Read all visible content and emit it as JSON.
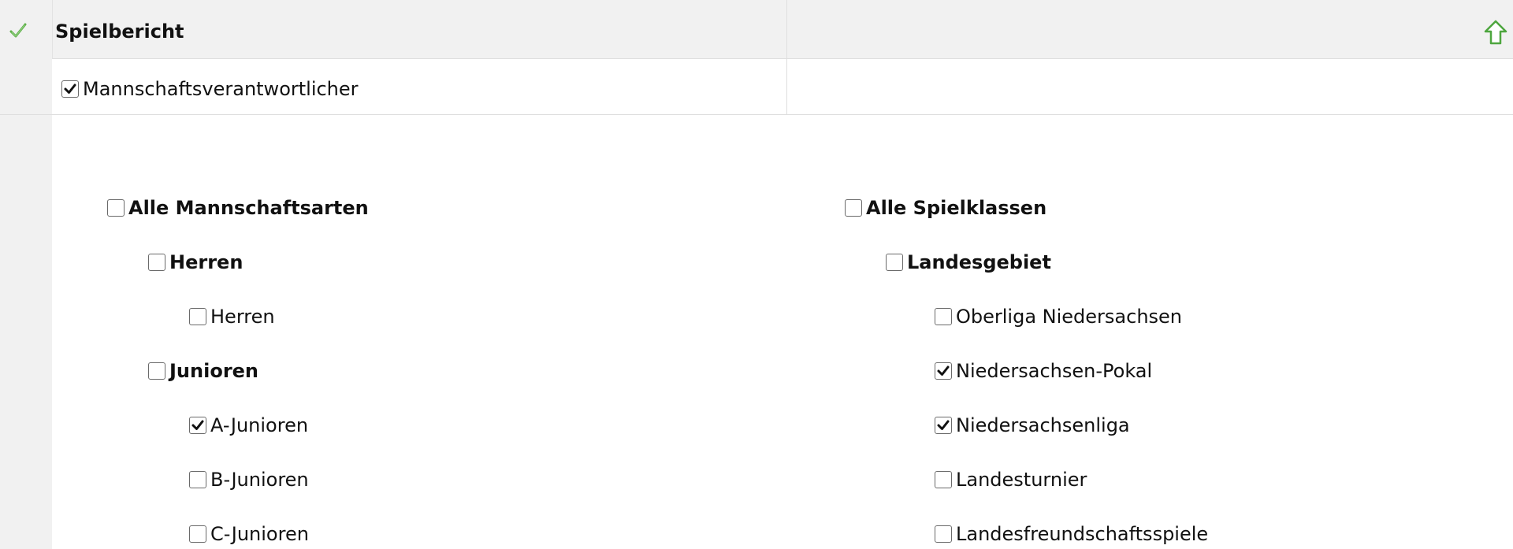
{
  "header": {
    "title": "Spielbericht",
    "status_icon": "green-check-icon",
    "action_icon": "green-up-arrow-icon"
  },
  "role_option": {
    "label": "Mannschaftsverantwortlicher",
    "checked": true
  },
  "left_column": [
    {
      "label": "Alle Mannschaftsarten",
      "bold": true,
      "level": 0,
      "checked": false
    },
    {
      "label": "Herren",
      "bold": true,
      "level": 1,
      "checked": false
    },
    {
      "label": "Herren",
      "bold": false,
      "level": 2,
      "checked": false
    },
    {
      "label": "Junioren",
      "bold": true,
      "level": 1,
      "checked": false
    },
    {
      "label": "A-Junioren",
      "bold": false,
      "level": 2,
      "checked": true
    },
    {
      "label": "B-Junioren",
      "bold": false,
      "level": 2,
      "checked": false
    },
    {
      "label": "C-Junioren",
      "bold": false,
      "level": 2,
      "checked": false
    }
  ],
  "right_column": [
    {
      "label": "Alle Spielklassen",
      "bold": true,
      "level": 0,
      "checked": false
    },
    {
      "label": "Landesgebiet",
      "bold": true,
      "level": 1,
      "checked": false
    },
    {
      "label": "Oberliga Niedersachsen",
      "bold": false,
      "level": 2,
      "checked": false
    },
    {
      "label": "Niedersachsen-Pokal",
      "bold": false,
      "level": 2,
      "checked": true
    },
    {
      "label": "Niedersachsenliga",
      "bold": false,
      "level": 2,
      "checked": true
    },
    {
      "label": "Landesturnier",
      "bold": false,
      "level": 2,
      "checked": false
    },
    {
      "label": "Landesfreundschaftsspiele",
      "bold": false,
      "level": 2,
      "checked": false
    }
  ],
  "colors": {
    "check_green": "#5fb04a",
    "header_bg": "#f1f1f1",
    "border": "#dedede"
  }
}
